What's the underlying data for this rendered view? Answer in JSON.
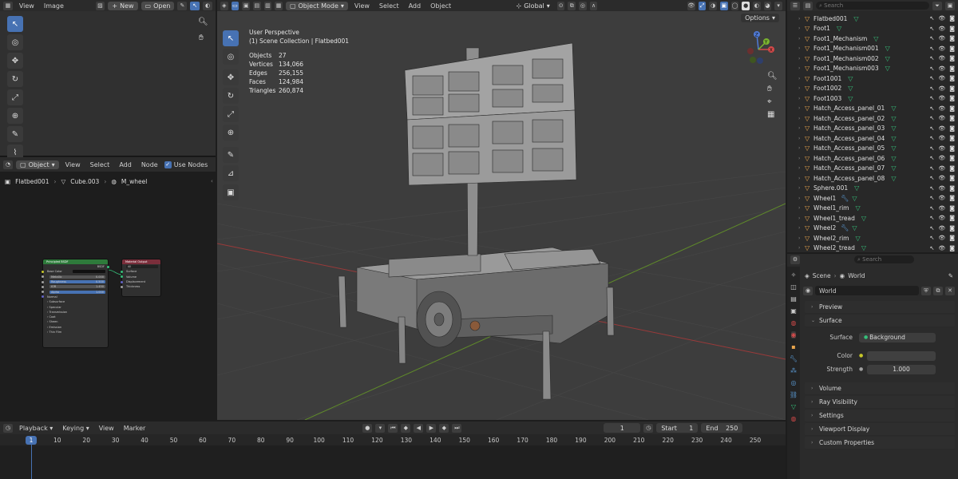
{
  "image_editor": {
    "menu": [
      "View",
      "Image"
    ],
    "new_label": "New",
    "open_label": "Open"
  },
  "node_editor": {
    "object_mode": "Object",
    "menu": [
      "View",
      "Select",
      "Add",
      "Node"
    ],
    "use_nodes_label": "Use Nodes",
    "breadcrumb": [
      "Flatbed001",
      "Cube.003",
      "M_wheel"
    ],
    "bsdf": {
      "title": "Principled BSDF",
      "out": "BSDF",
      "rows": [
        "Base Color",
        "Metallic",
        "Roughness",
        "IOR",
        "Alpha",
        "Normal",
        "Subsurface",
        "Specular",
        "Transmission",
        "Coat",
        "Sheen",
        "Emission",
        "Thin Film"
      ],
      "metallic": "0.000",
      "roughness": "0.500",
      "ior": "1.450",
      "alpha": "1.000"
    },
    "output": {
      "title": "Material Output",
      "target": "All",
      "rows": [
        "Surface",
        "Volume",
        "Displacement",
        "Thickness"
      ]
    }
  },
  "viewport": {
    "mode": "Object Mode",
    "menu": [
      "View",
      "Select",
      "Add",
      "Object"
    ],
    "orientation": "Global",
    "options_label": "Options",
    "perspective": "User Perspective",
    "collection": "(1) Scene Collection | Flatbed001",
    "stats": [
      {
        "label": "Objects",
        "value": "27"
      },
      {
        "label": "Vertices",
        "value": "134,066"
      },
      {
        "label": "Edges",
        "value": "256,155"
      },
      {
        "label": "Faces",
        "value": "124,984"
      },
      {
        "label": "Triangles",
        "value": "260,874"
      }
    ],
    "gizmo": {
      "x": "X",
      "y": "Y",
      "z": "Z"
    }
  },
  "outliner": {
    "search_placeholder": "Search",
    "items": [
      {
        "name": "Flatbed001",
        "mod": false
      },
      {
        "name": "Foot1",
        "mod": false
      },
      {
        "name": "Foot1_Mechanism",
        "mod": false
      },
      {
        "name": "Foot1_Mechanism001",
        "mod": false
      },
      {
        "name": "Foot1_Mechanism002",
        "mod": false
      },
      {
        "name": "Foot1_Mechanism003",
        "mod": false
      },
      {
        "name": "Foot1001",
        "mod": false
      },
      {
        "name": "Foot1002",
        "mod": false
      },
      {
        "name": "Foot1003",
        "mod": false
      },
      {
        "name": "Hatch_Access_panel_01",
        "mod": false
      },
      {
        "name": "Hatch_Access_panel_02",
        "mod": false
      },
      {
        "name": "Hatch_Access_panel_03",
        "mod": false
      },
      {
        "name": "Hatch_Access_panel_04",
        "mod": false
      },
      {
        "name": "Hatch_Access_panel_05",
        "mod": false
      },
      {
        "name": "Hatch_Access_panel_06",
        "mod": false
      },
      {
        "name": "Hatch_Access_panel_07",
        "mod": false
      },
      {
        "name": "Hatch_Access_panel_08",
        "mod": false
      },
      {
        "name": "Sphere.001",
        "mod": false
      },
      {
        "name": "Wheel1",
        "mod": true
      },
      {
        "name": "Wheel1_rim",
        "mod": false
      },
      {
        "name": "Wheel1_tread",
        "mod": false
      },
      {
        "name": "Wheel2",
        "mod": true
      },
      {
        "name": "Wheel2_rim",
        "mod": false
      },
      {
        "name": "Wheel2_tread",
        "mod": false
      }
    ]
  },
  "properties": {
    "search_placeholder": "Search",
    "breadcrumb_scene": "Scene",
    "breadcrumb_world": "World",
    "world_name": "World",
    "sections": {
      "preview": "Preview",
      "surface": "Surface",
      "volume": "Volume",
      "ray_visibility": "Ray Visibility",
      "settings": "Settings",
      "viewport_display": "Viewport Display",
      "custom_properties": "Custom Properties"
    },
    "surface_label": "Surface",
    "surface_value": "Background",
    "color_label": "Color",
    "strength_label": "Strength",
    "strength_value": "1.000"
  },
  "timeline": {
    "menu": [
      "Playback",
      "Keying",
      "View",
      "Marker"
    ],
    "current_frame": "1",
    "start_label": "Start",
    "start": "1",
    "end_label": "End",
    "end": "250",
    "frame_marker": "1",
    "ticks": [
      "10",
      "20",
      "30",
      "40",
      "50",
      "60",
      "70",
      "80",
      "90",
      "100",
      "110",
      "120",
      "130",
      "140",
      "150",
      "160",
      "170",
      "180",
      "190",
      "200",
      "210",
      "220",
      "230",
      "240",
      "250"
    ]
  },
  "colors": {
    "accent": "#4772b3",
    "object": "#e9a54d",
    "mesh": "#35c07a",
    "grid_x": "#9a3a3a",
    "grid_y": "#5f8a2a"
  }
}
